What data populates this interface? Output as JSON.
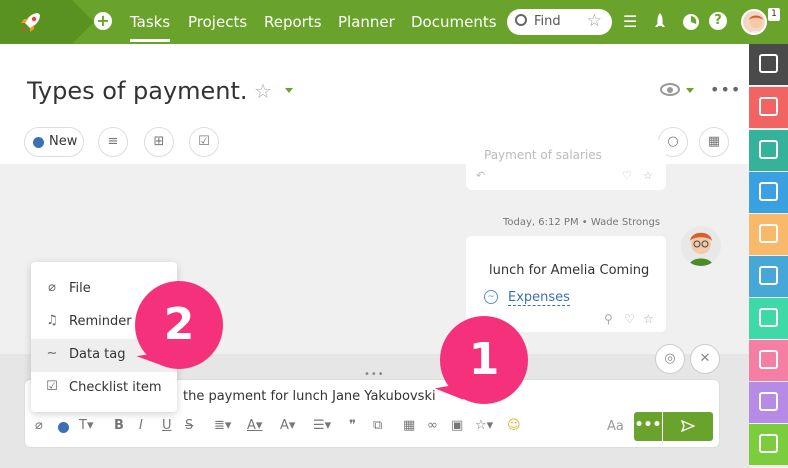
{
  "topbar": {
    "nav": [
      "Tasks",
      "Projects",
      "Reports",
      "Planner",
      "Documents"
    ],
    "active_nav": "Tasks",
    "search_placeholder": "Find",
    "notification_count": "1",
    "help_label": "?"
  },
  "header": {
    "title": "Types of payment.",
    "status_label": "New"
  },
  "chat": {
    "prev_message": "Payment of salaries",
    "meta": "Today, 6:12 PM • Wade Strongs",
    "message_text": "lunch  for Amelia Coming",
    "tag_label": "Expenses"
  },
  "composer": {
    "text": "the payment for lunch  Jane Yakubovski",
    "aa_label": "Aa",
    "more_label": "•••"
  },
  "popup": {
    "items": [
      {
        "icon": "paperclip-icon",
        "label": "File"
      },
      {
        "icon": "bell-icon",
        "label": "Reminder"
      },
      {
        "icon": "tag-icon",
        "label": "Data tag"
      },
      {
        "icon": "checkbox-icon",
        "label": "Checklist item"
      }
    ]
  },
  "callouts": [
    "2",
    "1"
  ],
  "sidebar_colors": [
    "#4a4a4a",
    "#f26363",
    "#34b29a",
    "#3aa0e0",
    "#f8b96b",
    "#47a8d8",
    "#3ed9a6",
    "#f57fa3",
    "#b58be6",
    "#7ccd3e"
  ],
  "colors": {
    "brand_green": "#6aa32b",
    "accent_pink": "#f5317b",
    "link_blue": "#3b6fb6"
  }
}
